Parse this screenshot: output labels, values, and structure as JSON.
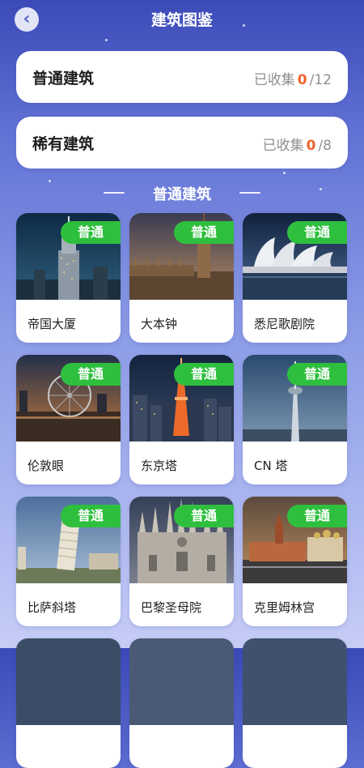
{
  "header": {
    "title": "建筑图鉴",
    "back_icon": "‹"
  },
  "summary": [
    {
      "name": "普通建筑",
      "prefix": "已收集",
      "collected": "0",
      "total": "/12"
    },
    {
      "name": "稀有建筑",
      "prefix": "已收集",
      "collected": "0",
      "total": "/8"
    }
  ],
  "section": {
    "title": "普通建筑"
  },
  "badge_color": "#2fbf3e",
  "accent_color": "#f0632f",
  "buildings": [
    {
      "name": "帝国大厦",
      "badge": "普通",
      "photo": "empire-state-building"
    },
    {
      "name": "大本钟",
      "badge": "普通",
      "photo": "big-ben"
    },
    {
      "name": "悉尼歌剧院",
      "badge": "普通",
      "photo": "sydney-opera-house"
    },
    {
      "name": "伦敦眼",
      "badge": "普通",
      "photo": "london-eye"
    },
    {
      "name": "东京塔",
      "badge": "普通",
      "photo": "tokyo-tower"
    },
    {
      "name": "CN 塔",
      "badge": "普通",
      "photo": "cn-tower"
    },
    {
      "name": "比萨斜塔",
      "badge": "普通",
      "photo": "leaning-tower-of-pisa"
    },
    {
      "name": "巴黎圣母院",
      "badge": "普通",
      "photo": "notre-dame"
    },
    {
      "name": "克里姆林宫",
      "badge": "普通",
      "photo": "kremlin"
    }
  ]
}
